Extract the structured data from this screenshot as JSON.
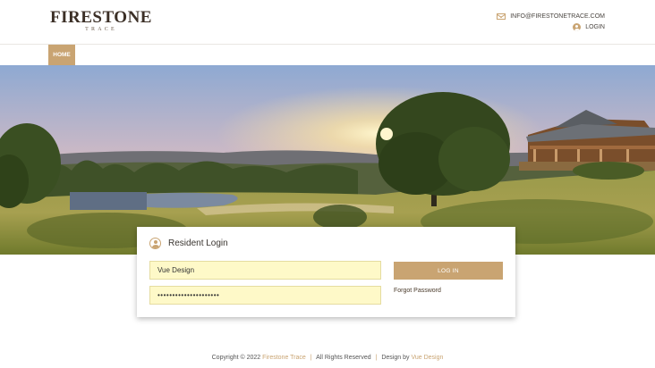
{
  "brand": {
    "name": "FIRESTONE",
    "subtitle": "TRACE"
  },
  "contact": {
    "email": "INFO@FIRESTONETRACE.COM",
    "login": "LOGIN"
  },
  "nav": {
    "home": "HOME"
  },
  "login_card": {
    "title": "Resident Login",
    "username_value": "Vue Design",
    "password_value": "•••••••••••••••••••••",
    "login_button": "LOG IN",
    "forgot_password": "Forgot Password"
  },
  "footer": {
    "copyright": "Copyright © 2022",
    "site_name": "Firestone Trace",
    "rights": "All Rights Reserved",
    "design_by": "Design by",
    "designer": "Vue Design",
    "separator": "|"
  },
  "colors": {
    "accent": "#c9a472",
    "input_bg": "#fef9c8",
    "logo": "#3b2f26"
  }
}
